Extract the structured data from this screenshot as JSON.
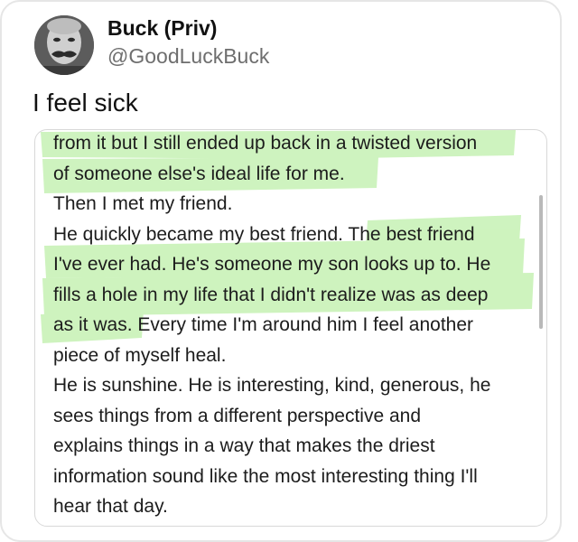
{
  "post": {
    "author": {
      "display_name": "Buck (Priv)",
      "handle": "@GoodLuckBuck"
    },
    "text": "I feel sick",
    "screenshot_note": {
      "lines": [
        "from it but I still ended up back in a twisted version",
        "of someone else's ideal life for me.",
        "Then I met my friend.",
        "He quickly became my best friend. The best friend",
        "I've ever had. He's someone my son looks up to. He",
        "fills a hole in my life that I didn't realize was as deep",
        "as it was. Every time I'm around him I feel another",
        "piece of myself heal.",
        "He is sunshine. He is interesting, kind, generous, he",
        "sees things from a different perspective and",
        "explains things in a way that makes the driest",
        "information sound like the most interesting thing I'll",
        "hear that day."
      ]
    }
  },
  "colors": {
    "highlight": "#c9f2b8",
    "text": "#1c1c1c",
    "handle": "#6e6e6e",
    "border": "#e6e6e6"
  }
}
